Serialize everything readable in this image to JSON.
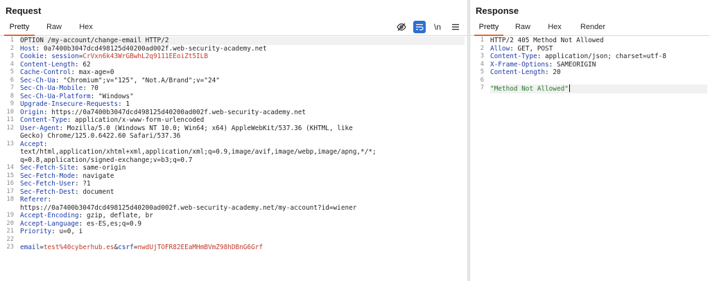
{
  "request": {
    "title": "Request",
    "tabs": [
      {
        "label": "Pretty",
        "active": true
      },
      {
        "label": "Raw",
        "active": false
      },
      {
        "label": "Hex",
        "active": false
      }
    ],
    "tools": [
      "eye-slash-icon",
      "wrap-icon",
      "newline-icon",
      "menu-icon"
    ],
    "newline_label": "\\n",
    "lines": [
      {
        "n": "1",
        "text": "OPTION /my-account/change-email HTTP/2"
      },
      {
        "n": "2",
        "key": "Host",
        "value": " 0a7400b3047dcd498125d40200ad002f.web-security-academy.net"
      },
      {
        "n": "3",
        "key": "Cookie",
        "cookie_name": "session",
        "cookie_value": "CrVxn6k43WrGBwhL2q9111EEoiZt5ILB"
      },
      {
        "n": "4",
        "key": "Content-Length",
        "value": " 62"
      },
      {
        "n": "5",
        "key": "Cache-Control",
        "value": " max-age=0"
      },
      {
        "n": "6",
        "key": "Sec-Ch-Ua",
        "value": " \"Chromium\";v=\"125\", \"Not.A/Brand\";v=\"24\""
      },
      {
        "n": "7",
        "key": "Sec-Ch-Ua-Mobile",
        "value": " ?0"
      },
      {
        "n": "8",
        "key": "Sec-Ch-Ua-Platform",
        "value": " \"Windows\""
      },
      {
        "n": "9",
        "key": "Upgrade-Insecure-Requests",
        "value": " 1"
      },
      {
        "n": "10",
        "key": "Origin",
        "value": " https://0a7400b3047dcd498125d40200ad002f.web-security-academy.net"
      },
      {
        "n": "11",
        "key": "Content-Type",
        "value": " application/x-www-form-urlencoded"
      },
      {
        "n": "12",
        "key": "User-Agent",
        "value": " Mozilla/5.0 (Windows NT 10.0; Win64; x64) AppleWebKit/537.36 (KHTML, like"
      },
      {
        "n": "",
        "text": "Gecko) Chrome/125.0.6422.60 Safari/537.36"
      },
      {
        "n": "13",
        "key": "Accept",
        "value": ""
      },
      {
        "n": "",
        "text": "text/html,application/xhtml+xml,application/xml;q=0.9,image/avif,image/webp,image/apng,*/*;"
      },
      {
        "n": "",
        "text": "q=0.8,application/signed-exchange;v=b3;q=0.7"
      },
      {
        "n": "14",
        "key": "Sec-Fetch-Site",
        "value": " same-origin"
      },
      {
        "n": "15",
        "key": "Sec-Fetch-Mode",
        "value": " navigate"
      },
      {
        "n": "16",
        "key": "Sec-Fetch-User",
        "value": " ?1"
      },
      {
        "n": "17",
        "key": "Sec-Fetch-Dest",
        "value": " document"
      },
      {
        "n": "18",
        "key": "Referer",
        "value": ""
      },
      {
        "n": "",
        "text": "https://0a7400b3047dcd498125d40200ad002f.web-security-academy.net/my-account?id=wiener"
      },
      {
        "n": "19",
        "key": "Accept-Encoding",
        "value": " gzip, deflate, br"
      },
      {
        "n": "20",
        "key": "Accept-Language",
        "value": " es-ES,es;q=0.9"
      },
      {
        "n": "21",
        "key": "Priority",
        "value": " u=0, i"
      },
      {
        "n": "22",
        "text": ""
      },
      {
        "n": "23",
        "params": [
          {
            "name": "email",
            "value": "test%40cyberhub.es"
          },
          {
            "name": "csrf",
            "value": "nwdUjTOFR82EEaMHmBVmZ98hDBnG6Grf"
          }
        ]
      }
    ]
  },
  "response": {
    "title": "Response",
    "tabs": [
      {
        "label": "Pretty",
        "active": true
      },
      {
        "label": "Raw",
        "active": false
      },
      {
        "label": "Hex",
        "active": false
      },
      {
        "label": "Render",
        "active": false
      }
    ],
    "lines": [
      {
        "n": "1",
        "text": "HTTP/2 405 Method Not Allowed"
      },
      {
        "n": "2",
        "key": "Allow",
        "value": " GET, POST"
      },
      {
        "n": "3",
        "key": "Content-Type",
        "value": " application/json; charset=utf-8"
      },
      {
        "n": "4",
        "key": "X-Frame-Options",
        "value": " SAMEORIGIN"
      },
      {
        "n": "5",
        "key": "Content-Length",
        "value": " 20"
      },
      {
        "n": "6",
        "text": ""
      },
      {
        "n": "7",
        "string": "\"Method Not Allowed\""
      }
    ]
  }
}
